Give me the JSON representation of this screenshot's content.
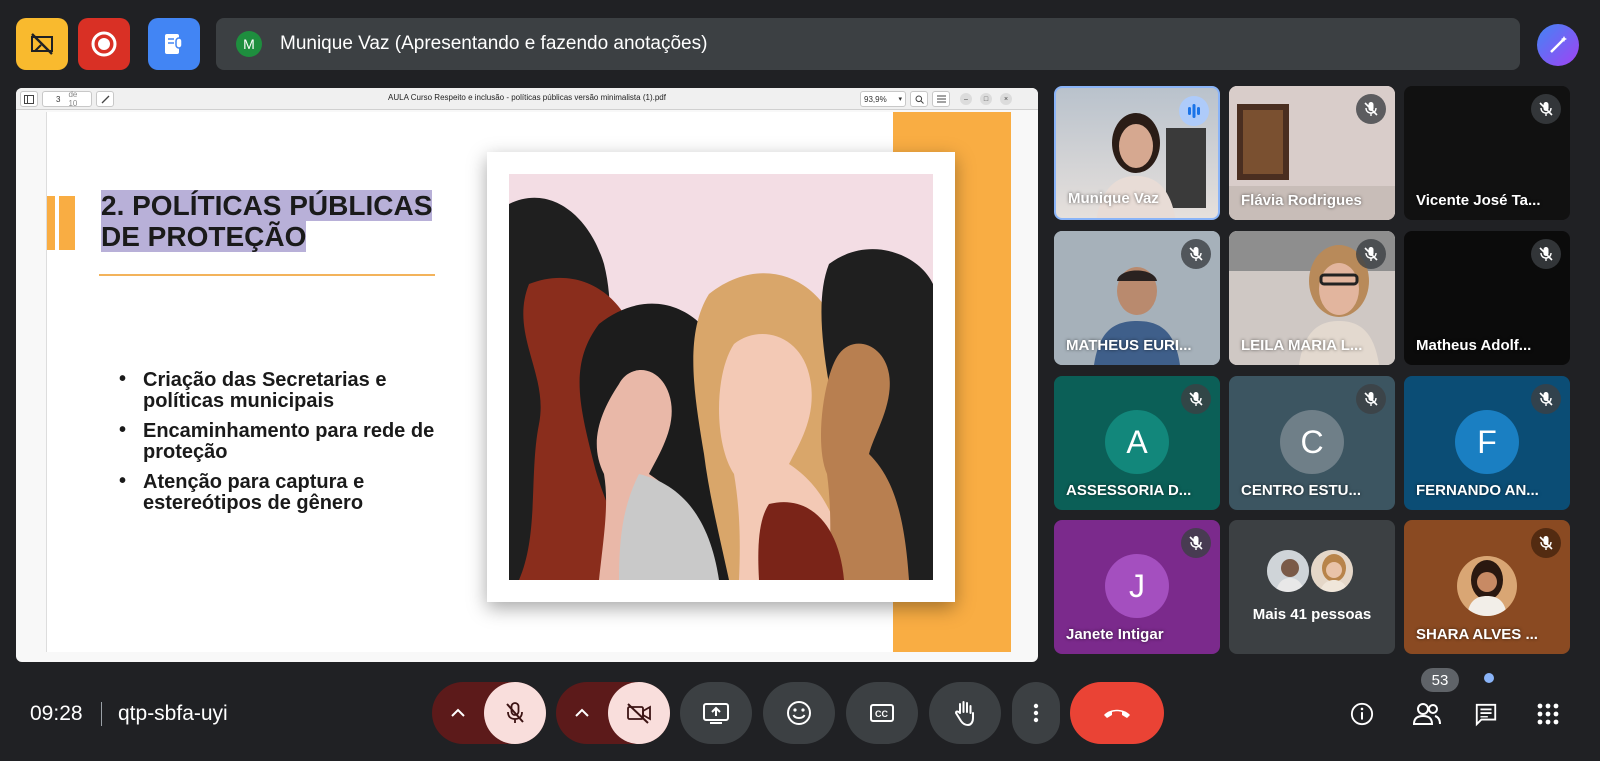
{
  "presenter": {
    "initial": "M",
    "label": "Munique Vaz (Apresentando e fazendo anotações)"
  },
  "viewer": {
    "page_current": "3",
    "page_total": "de 10",
    "doc_title": "AULA Curso Respeito e inclusão - políticas públicas versão minimalista (1).pdf",
    "zoom": "93,9%"
  },
  "slide": {
    "title_line1": "2. POLÍTICAS PÚBLICAS",
    "title_line2": "DE PROTEÇÃO",
    "bullets": [
      {
        "line1": "Criação das Secretarias e",
        "line2": "políticas municipais"
      },
      {
        "line1": "Encaminhamento para rede de",
        "line2": "proteção"
      },
      {
        "line1": "Atenção para captura e",
        "line2": "estereótipos de gênero"
      }
    ]
  },
  "participants": [
    {
      "name": "Munique Vaz",
      "type": "video"
    },
    {
      "name": "Flávia Rodrigues",
      "type": "video"
    },
    {
      "name": "Vicente José Ta...",
      "type": "black"
    },
    {
      "name": "MATHEUS EURI...",
      "type": "video"
    },
    {
      "name": "LEILA MARIA L...",
      "type": "video"
    },
    {
      "name": "Matheus Adolf...",
      "type": "black"
    },
    {
      "name": "ASSESSORIA D...",
      "initial": "A",
      "bg": "#0b5f57",
      "avatar": "#12877b"
    },
    {
      "name": "CENTRO ESTU...",
      "initial": "C",
      "bg": "#3c5561",
      "avatar": "#6f7f88"
    },
    {
      "name": "FERNANDO AN...",
      "initial": "F",
      "bg": "#0b4d75",
      "avatar": "#1a7fc2"
    },
    {
      "name": "Janete Intigar",
      "initial": "J",
      "bg": "#7b2a8c",
      "avatar": "#a44fbf"
    },
    {
      "name": "Mais 41 pessoas",
      "type": "more"
    },
    {
      "name": "SHARA ALVES ...",
      "type": "photo"
    }
  ],
  "bottom": {
    "time": "09:28",
    "meeting_code": "qtp-sbfa-uyi",
    "people_count": "53"
  },
  "colors": {
    "end_call": "#ea4335",
    "record": "#d93025",
    "activity": "#4285f4",
    "accent_orange": "#f9ad43"
  }
}
